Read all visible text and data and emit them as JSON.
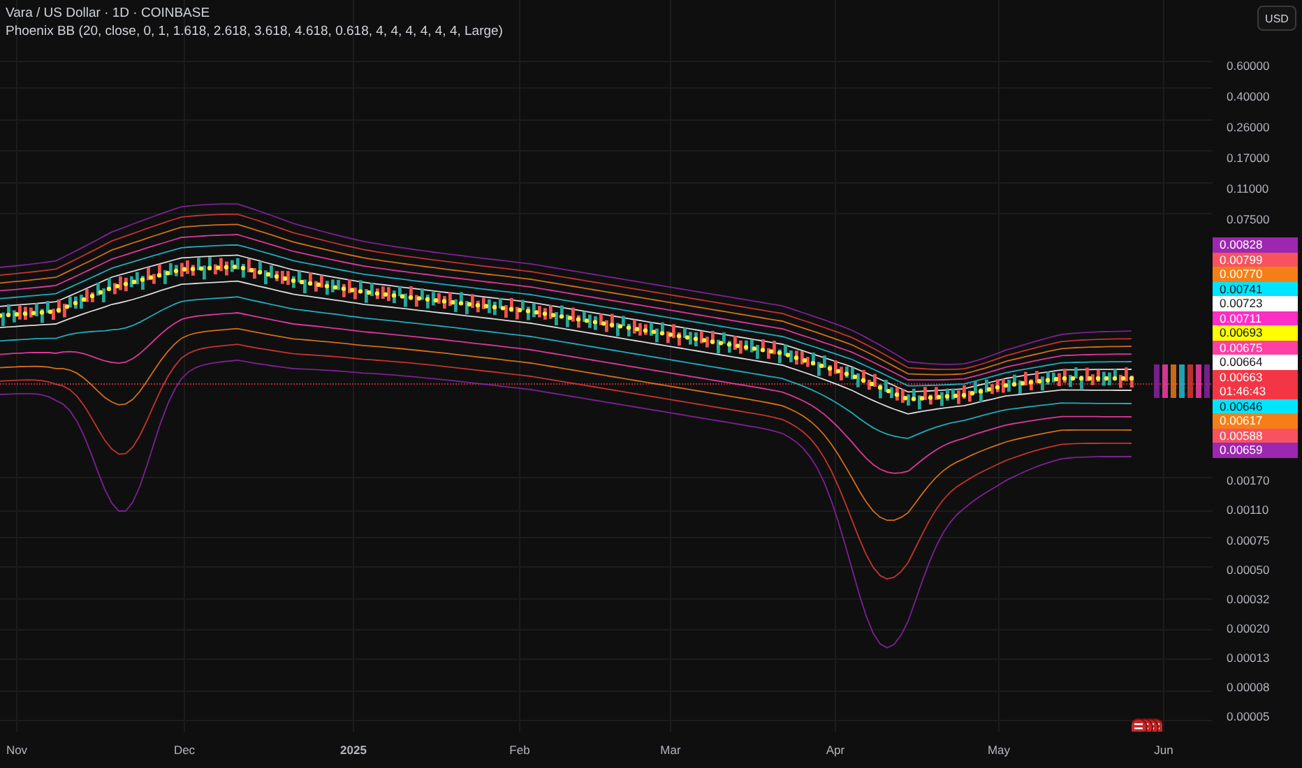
{
  "legend": {
    "title": "Vara / US Dollar · 1D · COINBASE",
    "indicator": "Phoenix BB (20, close, 0, 1, 1.618, 2.618, 3.618, 4.618, 0.618, 4, 4, 4, 4, 4, 4, Large)"
  },
  "currency_button": "USD",
  "price_axis_upper": [
    "0.60000",
    "0.40000",
    "0.26000",
    "0.17000",
    "0.11000",
    "0.07500"
  ],
  "price_tags": [
    {
      "value": "0.00828",
      "color": "#9c27b0"
    },
    {
      "value": "0.00799",
      "color": "#f7525f"
    },
    {
      "value": "0.00770",
      "color": "#f57f17"
    },
    {
      "value": "0.00741",
      "color": "#00e5ff"
    },
    {
      "value": "0.00723",
      "color": "#ffffff"
    },
    {
      "value": "0.00711",
      "color": "#ff2ec4"
    },
    {
      "value": "0.00693",
      "color": "#ffff00"
    },
    {
      "value": "0.00675",
      "color": "#ff3fa4"
    },
    {
      "value": "0.00664",
      "color": "#ffffff"
    },
    {
      "value": "0.00663",
      "countdown": "01:46:43",
      "color": "#f23645"
    },
    {
      "value": "0.00646",
      "color": "#00e5ff"
    },
    {
      "value": "0.00617",
      "color": "#f57f17"
    },
    {
      "value": "0.00588",
      "color": "#f7525f"
    },
    {
      "value": "0.00659",
      "color": "#9c27b0"
    }
  ],
  "price_axis_lower": [
    "0.00170",
    "0.00110",
    "0.00075",
    "0.00050",
    "0.00032",
    "0.00020",
    "0.00013",
    "0.00008",
    "0.00005"
  ],
  "time_axis": [
    {
      "label": "Nov",
      "kind": "month"
    },
    {
      "label": "Dec",
      "kind": "month"
    },
    {
      "label": "2025",
      "kind": "year"
    },
    {
      "label": "Feb",
      "kind": "month"
    },
    {
      "label": "Mar",
      "kind": "month"
    },
    {
      "label": "Apr",
      "kind": "month"
    },
    {
      "label": "May",
      "kind": "month"
    },
    {
      "label": "Jun",
      "kind": "month"
    }
  ]
}
